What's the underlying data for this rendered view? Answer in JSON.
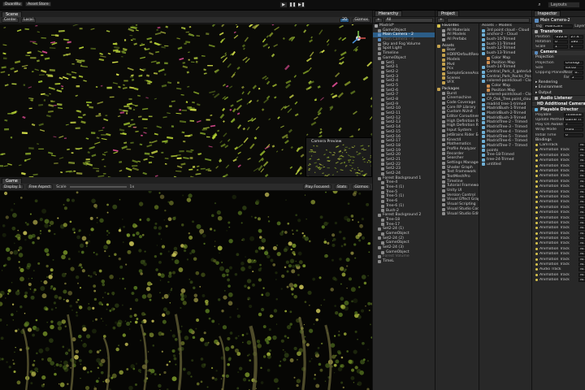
{
  "app": {
    "top_left": "DuanWu",
    "top_tab2": "Asset Store",
    "layout": "Layouts",
    "play_icons": [
      "▶",
      "❚❚",
      "▶❚"
    ]
  },
  "scene": {
    "tabs": [
      "Scene"
    ],
    "toolbar": [
      "Center",
      "Local",
      "2D",
      "Gizmos"
    ],
    "preview_title": "Camera Preview"
  },
  "game": {
    "tab": "Game",
    "display": "Display 1",
    "aspect": "Free Aspect",
    "scale_label": "Scale",
    "scale_value": "1x",
    "play_mode": "Play Focused",
    "stats": "Stats",
    "gizmos": "Gizmos"
  },
  "hierarchy": {
    "tab": "Hierarchy",
    "search_placeholder": "All",
    "items": [
      {
        "label": "Madrid*",
        "indent": 0,
        "icon": "scene",
        "state": ""
      },
      {
        "label": "GameObject",
        "indent": 1,
        "icon": "go",
        "state": ""
      },
      {
        "label": "Main Camera - 2",
        "indent": 1,
        "icon": "cam",
        "state": "sel"
      },
      {
        "label": "Main Camera - 3",
        "indent": 1,
        "icon": "cam",
        "state": "dim"
      },
      {
        "label": "Sky and Fog Volume",
        "indent": 1,
        "icon": "go",
        "state": ""
      },
      {
        "label": "Spot Light",
        "indent": 1,
        "icon": "go",
        "state": ""
      },
      {
        "label": "Timeline",
        "indent": 1,
        "icon": "go",
        "state": ""
      },
      {
        "label": "GameObject",
        "indent": 1,
        "icon": "go",
        "state": ""
      },
      {
        "label": "Set1",
        "indent": 2,
        "icon": "go",
        "state": ""
      },
      {
        "label": "Set2-1",
        "indent": 2,
        "icon": "go",
        "state": ""
      },
      {
        "label": "Set2-2",
        "indent": 2,
        "icon": "go",
        "state": ""
      },
      {
        "label": "Set2-3",
        "indent": 2,
        "icon": "go",
        "state": ""
      },
      {
        "label": "Set2-4",
        "indent": 2,
        "icon": "go",
        "state": ""
      },
      {
        "label": "Set2-5",
        "indent": 2,
        "icon": "go",
        "state": ""
      },
      {
        "label": "Set2-6",
        "indent": 2,
        "icon": "go",
        "state": ""
      },
      {
        "label": "Set2-7",
        "indent": 2,
        "icon": "go",
        "state": ""
      },
      {
        "label": "Set2-8",
        "indent": 2,
        "icon": "go",
        "state": ""
      },
      {
        "label": "Set2-9",
        "indent": 2,
        "icon": "go",
        "state": ""
      },
      {
        "label": "Set2-10",
        "indent": 2,
        "icon": "go",
        "state": ""
      },
      {
        "label": "Set2-11",
        "indent": 2,
        "icon": "go",
        "state": ""
      },
      {
        "label": "Set2-12",
        "indent": 2,
        "icon": "go",
        "state": ""
      },
      {
        "label": "Set2-13",
        "indent": 2,
        "icon": "go",
        "state": ""
      },
      {
        "label": "Set2-14",
        "indent": 2,
        "icon": "go",
        "state": ""
      },
      {
        "label": "Set2-15",
        "indent": 2,
        "icon": "go",
        "state": ""
      },
      {
        "label": "Set2-16",
        "indent": 2,
        "icon": "go",
        "state": ""
      },
      {
        "label": "Set2-17",
        "indent": 2,
        "icon": "go",
        "state": ""
      },
      {
        "label": "Set2-18",
        "indent": 2,
        "icon": "go",
        "state": ""
      },
      {
        "label": "Set2-19",
        "indent": 2,
        "icon": "go",
        "state": ""
      },
      {
        "label": "Set2-20",
        "indent": 2,
        "icon": "go",
        "state": ""
      },
      {
        "label": "Set2-21",
        "indent": 2,
        "icon": "go",
        "state": ""
      },
      {
        "label": "Set2-22",
        "indent": 2,
        "icon": "go",
        "state": ""
      },
      {
        "label": "Set2-23",
        "indent": 2,
        "icon": "go",
        "state": ""
      },
      {
        "label": "Set2-24",
        "indent": 2,
        "icon": "go",
        "state": ""
      },
      {
        "label": "Forest Background 1",
        "indent": 1,
        "icon": "go",
        "state": ""
      },
      {
        "label": "Tree-4",
        "indent": 2,
        "icon": "go",
        "state": ""
      },
      {
        "label": "Tree-4 (1)",
        "indent": 2,
        "icon": "go",
        "state": ""
      },
      {
        "label": "Tree-5",
        "indent": 2,
        "icon": "go",
        "state": ""
      },
      {
        "label": "Tree-5 (1)",
        "indent": 2,
        "icon": "go",
        "state": ""
      },
      {
        "label": "Tree-6",
        "indent": 2,
        "icon": "go",
        "state": ""
      },
      {
        "label": "Tree-6 (1)",
        "indent": 2,
        "icon": "go",
        "state": ""
      },
      {
        "label": "Bush-2",
        "indent": 2,
        "icon": "go",
        "state": ""
      },
      {
        "label": "Forest Background 2",
        "indent": 1,
        "icon": "go",
        "state": ""
      },
      {
        "label": "Tree-18",
        "indent": 2,
        "icon": "go",
        "state": ""
      },
      {
        "label": "Tree-17",
        "indent": 2,
        "icon": "go",
        "state": ""
      },
      {
        "label": "Set2-24 (1)",
        "indent": 1,
        "icon": "go",
        "state": ""
      },
      {
        "label": "GameObject",
        "indent": 2,
        "icon": "go",
        "state": ""
      },
      {
        "label": "Set2-24 (2)",
        "indent": 1,
        "icon": "go",
        "state": ""
      },
      {
        "label": "GameObject",
        "indent": 2,
        "icon": "go",
        "state": ""
      },
      {
        "label": "Set2-24 (3)",
        "indent": 1,
        "icon": "go",
        "state": ""
      },
      {
        "label": "GameObject",
        "indent": 2,
        "icon": "go",
        "state": ""
      },
      {
        "label": "Forest Volume",
        "indent": 1,
        "icon": "go",
        "state": "dim"
      },
      {
        "label": "TimeL",
        "indent": 1,
        "icon": "go",
        "state": ""
      }
    ]
  },
  "project": {
    "tab": "Project",
    "breadcrumb": [
      "Assets",
      "Models"
    ],
    "favorites_label": "Favorites",
    "favorites": [
      "All Materials",
      "All Models",
      "All Prefabs"
    ],
    "assets_label": "Assets",
    "assets": [
      "Boar",
      "HDRPDefaultReso",
      "Models",
      "Mvd",
      "Pcx",
      "SampleSceneAss",
      "Scenes",
      "VFX"
    ],
    "packages_label": "Packages",
    "packages": [
      "Burst",
      "Cinemachine",
      "Code Coverage",
      "Core RP Library",
      "Custom NUnit",
      "Editor Coroutines",
      "High Definition RP",
      "High Definition RP",
      "Input System",
      "JetBrains Rider Ed",
      "Kinect4",
      "Mathematics",
      "Profile Analyzer",
      "Recorder",
      "Searcher",
      "Settings Manager",
      "Shader Graph",
      "Test Framework",
      "TextMeshPro",
      "Timeline",
      "Tutorial Framework",
      "Unity UI",
      "Version Control",
      "Visual Effect Grap",
      "Visual Scripting",
      "Visual Studio Cod",
      "Visual Studio Edit"
    ],
    "files": [
      {
        "label": "3rd point cloud - Cloud",
        "icon": "mesh"
      },
      {
        "label": "anchor-2 - Cloud",
        "icon": "mesh"
      },
      {
        "label": "bush-10-Trimed",
        "icon": "mesh"
      },
      {
        "label": "bush-11-Trimed",
        "icon": "mesh"
      },
      {
        "label": "bush-12-Trimed",
        "icon": "mesh"
      },
      {
        "label": "bush-13-Trimed",
        "icon": "mesh"
      },
      {
        "label": "Color Map",
        "icon": "tex"
      },
      {
        "label": "Position Map",
        "icon": "tex"
      },
      {
        "label": "bush-14-Trimed",
        "icon": "mesh"
      },
      {
        "label": "Central_Park_4_gaterLdo",
        "icon": "mesh"
      },
      {
        "label": "Central_Park_Rocks_Pos",
        "icon": "mesh"
      },
      {
        "label": "colored-pointcloud - Clou",
        "icon": "mesh"
      },
      {
        "label": "Color Map",
        "icon": "tex"
      },
      {
        "label": "Position Map",
        "icon": "tex"
      },
      {
        "label": "colored-pointcloud - Clou",
        "icon": "mesh"
      },
      {
        "label": "CP_Oak_Tree.point_clou",
        "icon": "mesh"
      },
      {
        "label": "madrid tree-1-trimed",
        "icon": "mesh"
      },
      {
        "label": "MadridBush-1-Trimed",
        "icon": "mesh"
      },
      {
        "label": "MadridBush-2-Trimed",
        "icon": "mesh"
      },
      {
        "label": "MadridBush-3-Trimed",
        "icon": "mesh"
      },
      {
        "label": "MadridTree-2 - Trimed",
        "icon": "mesh"
      },
      {
        "label": "MadridTree-3 - Trimed",
        "icon": "mesh"
      },
      {
        "label": "MadridTree-4 - Trimed",
        "icon": "mesh"
      },
      {
        "label": "MadridTree-5 - Trimed",
        "icon": "mesh"
      },
      {
        "label": "MadridTree-6 - Trimed",
        "icon": "mesh"
      },
      {
        "label": "MadridTree-7 - Trimed",
        "icon": "mesh"
      },
      {
        "label": "points",
        "icon": "mesh"
      },
      {
        "label": "Tree-18-Trimed",
        "icon": "mesh"
      },
      {
        "label": "tree-24-Trimed",
        "icon": "mesh"
      },
      {
        "label": "untitled",
        "icon": "mesh"
      }
    ]
  },
  "inspector": {
    "tab": "Inspector",
    "object_name": "Main Camera-2",
    "tag_label": "Tag",
    "tag_value": "MainCam",
    "layer_label": "Layer",
    "transform": {
      "title": "Transform",
      "rows": [
        {
          "label": "Position",
          "x": "-222.6",
          "y": "27.4"
        },
        {
          "label": "Rotation",
          "x": "0",
          "y": "180"
        },
        {
          "label": "Scale",
          "x": "1",
          "y": "1"
        }
      ]
    },
    "camera": {
      "title": "Camera",
      "projection_header": "Projection",
      "projection_label": "Projection",
      "projection_value": "Orthogr",
      "size_label": "Size",
      "size_value": "43.02",
      "clipping_label": "Clipping Planes",
      "near_label": "Near",
      "near_value": "0.",
      "far_label": "Far",
      "far_value": "5",
      "sections": [
        "Rendering",
        "Environment",
        "Output"
      ]
    },
    "components": [
      "Audio Listener",
      "HD Additional Camera"
    ],
    "director": {
      "title": "Playable Director",
      "rows": [
        {
          "label": "Playable",
          "value": "Timeline"
        },
        {
          "label": "Update Method",
          "value": "Game Ti"
        },
        {
          "label": "Play On Awake",
          "value": "✓"
        },
        {
          "label": "Wrap Mode",
          "value": "Hold"
        },
        {
          "label": "Initial Time",
          "value": "0"
        }
      ],
      "bindings_label": "Bindings",
      "tracks": [
        {
          "label": "CamTrack",
          "value": "Non"
        },
        {
          "label": "Animation Track",
          "value": "Non"
        },
        {
          "label": "Animation Track",
          "value": "Non"
        },
        {
          "label": "Animation Track",
          "value": "Non"
        },
        {
          "label": "Animation Track",
          "value": "Non"
        },
        {
          "label": "Animation Track",
          "value": "Non"
        },
        {
          "label": "Animation Track",
          "value": "Non"
        },
        {
          "label": "Animation Track",
          "value": "Non"
        },
        {
          "label": "Animation Track",
          "value": "Non"
        },
        {
          "label": "Animation Track",
          "value": "Non"
        },
        {
          "label": "Animation Track",
          "value": "Non"
        },
        {
          "label": "Animation Track",
          "value": "Non"
        },
        {
          "label": "Animation Track",
          "value": "Non"
        },
        {
          "label": "Animation Track",
          "value": "Non"
        },
        {
          "label": "Animation Track",
          "value": "Non"
        },
        {
          "label": "Animation Track",
          "value": "Non"
        },
        {
          "label": "Animation Track",
          "value": "Non"
        },
        {
          "label": "Animation Track",
          "value": "Non"
        },
        {
          "label": "Animation Track",
          "value": "Non"
        },
        {
          "label": "Animation Track",
          "value": "Non"
        },
        {
          "label": "Animation Track",
          "value": "Non"
        },
        {
          "label": "Animation Track",
          "value": "Non"
        },
        {
          "label": "Animation Track",
          "value": "Non"
        },
        {
          "label": "Animation Track",
          "value": "Non"
        },
        {
          "label": "Audio Track",
          "value": "Non"
        },
        {
          "label": "Animation Track",
          "value": "Non"
        },
        {
          "label": "Animation Track",
          "value": "Non"
        }
      ]
    }
  },
  "colors": {
    "selection": "#2c5d87",
    "scene_green": "#b7d234",
    "scene_pink": "#d84a8f",
    "folder": "#c4a24e"
  }
}
